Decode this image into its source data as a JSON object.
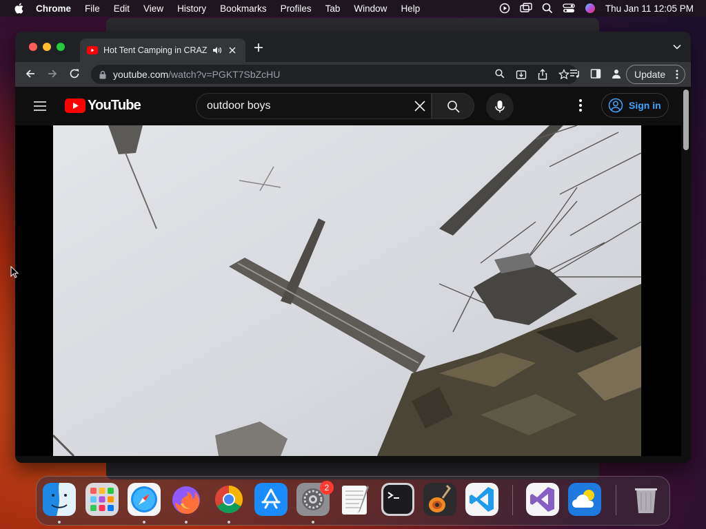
{
  "menubar": {
    "app_name": "Chrome",
    "items": [
      "File",
      "Edit",
      "View",
      "History",
      "Bookmarks",
      "Profiles",
      "Tab",
      "Window",
      "Help"
    ],
    "clock": "Thu Jan 11  12:05 PM"
  },
  "browser": {
    "tab": {
      "title": "Hot Tent Camping in CRAZY",
      "audio_icon": "speaker-icon"
    },
    "address": {
      "host": "youtube.com",
      "path": "/watch?v=PGKT7SbZcHU"
    },
    "update_label": "Update"
  },
  "youtube": {
    "logo_text": "YouTube",
    "search": {
      "value": "outdoor boys"
    },
    "signin_label": "Sign in"
  },
  "dock": {
    "apps": [
      "finder",
      "launchpad",
      "safari",
      "firefox",
      "chrome",
      "app-store",
      "system-settings",
      "textedit",
      "terminal",
      "garageband",
      "vscode",
      "visual-studio",
      "weather",
      "trash"
    ],
    "system_settings_badge": "2"
  },
  "colors": {
    "youtube_red": "#ff0000",
    "link_blue": "#3ea6ff",
    "chrome_dark": "#202124"
  }
}
